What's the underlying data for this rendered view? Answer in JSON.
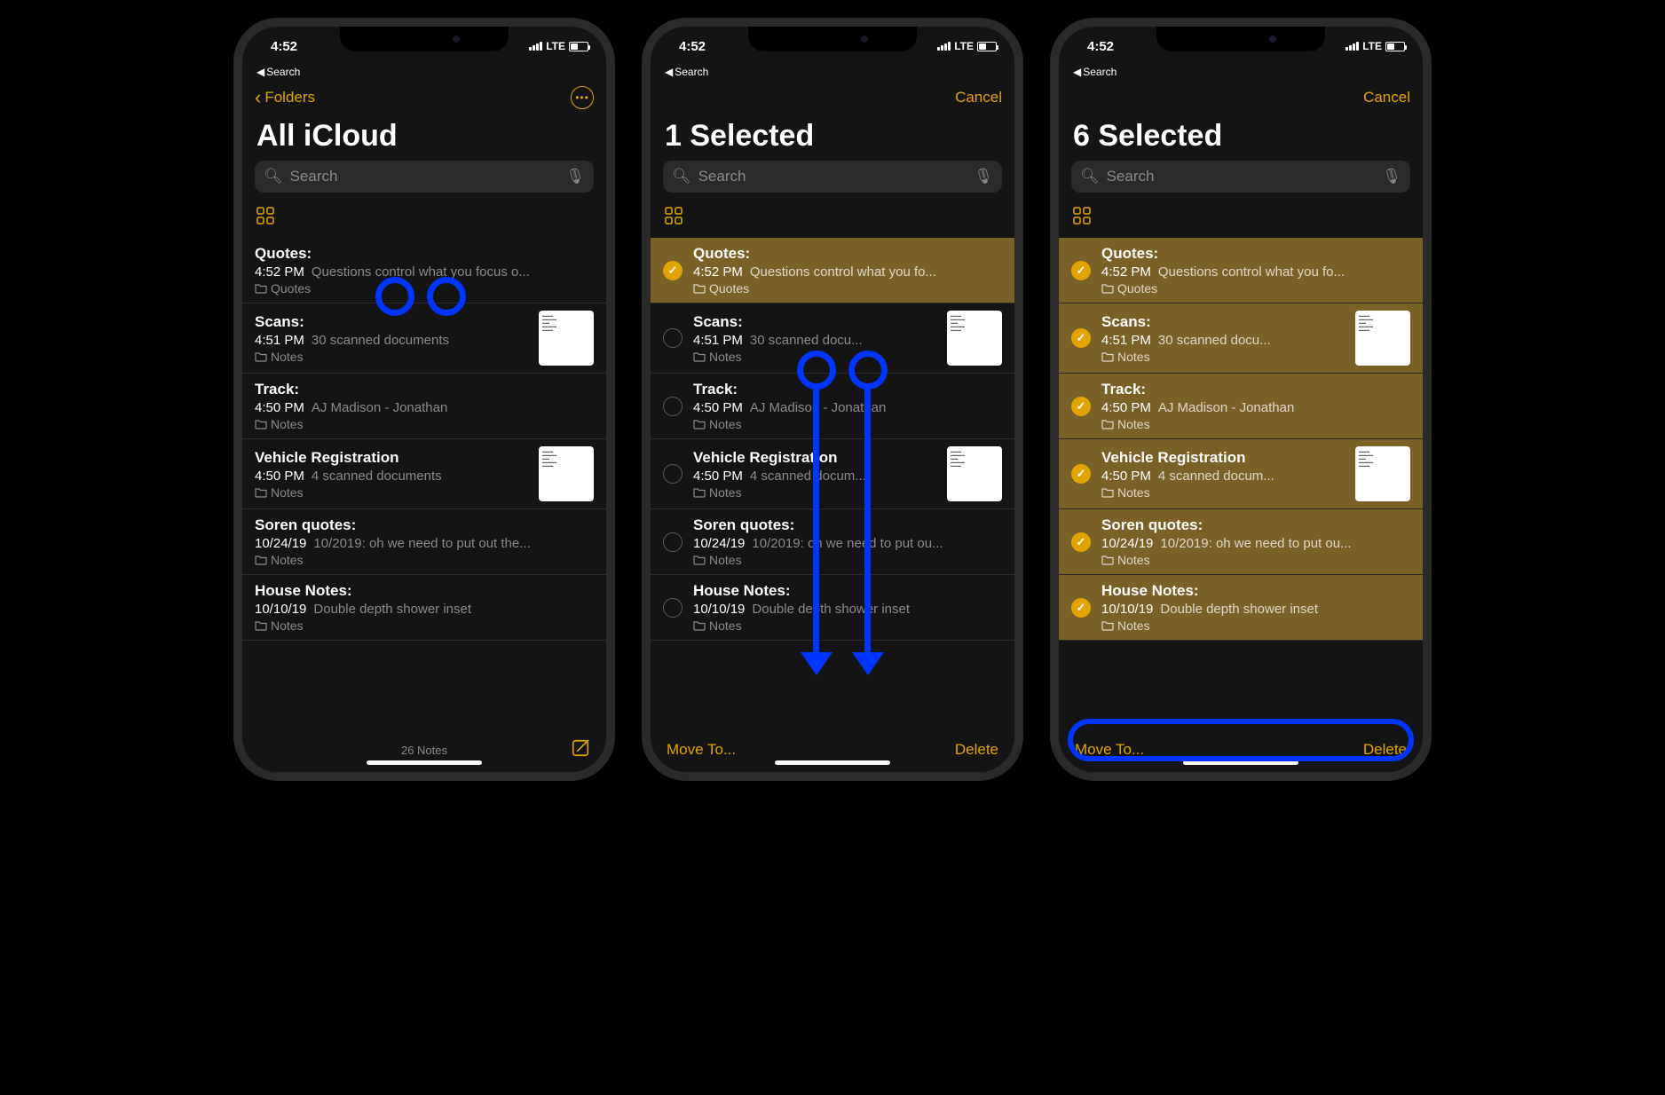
{
  "status": {
    "time": "4:52",
    "carrier": "LTE",
    "back_app": "Search"
  },
  "accent": "#e2a400",
  "phones": [
    {
      "nav": {
        "back": "Folders",
        "title": "All iCloud",
        "has_more": true
      },
      "search_placeholder": "Search",
      "footer": {
        "center": "26 Notes",
        "compose": true
      }
    },
    {
      "nav": {
        "cancel": "Cancel",
        "title": "1 Selected"
      },
      "search_placeholder": "Search",
      "footer": {
        "left": "Move To...",
        "right": "Delete"
      }
    },
    {
      "nav": {
        "cancel": "Cancel",
        "title": "6 Selected"
      },
      "search_placeholder": "Search",
      "footer": {
        "left": "Move To...",
        "right": "Delete"
      }
    }
  ],
  "notes": [
    {
      "title": "Quotes:",
      "time": "4:52 PM",
      "preview": "Questions control what you focus o...",
      "preview_mid": "Questions control what you fo...",
      "folder": "Quotes",
      "thumb": false
    },
    {
      "title": "Scans:",
      "time": "4:51 PM",
      "preview": "30 scanned documents",
      "preview_mid": "30 scanned docu...",
      "folder": "Notes",
      "thumb": true
    },
    {
      "title": "Track:",
      "time": "4:50 PM",
      "preview": "AJ Madison - Jonathan",
      "preview_mid": "AJ Madison - Jonathan",
      "folder": "Notes",
      "thumb": false
    },
    {
      "title": "Vehicle Registration",
      "time": "4:50 PM",
      "preview": "4 scanned documents",
      "preview_mid": "4 scanned docum...",
      "folder": "Notes",
      "thumb": true
    },
    {
      "title": "Soren quotes:",
      "time": "10/24/19",
      "preview": "10/2019: oh we need to put out the...",
      "preview_mid": "10/2019: oh we need to put ou...",
      "folder": "Notes",
      "thumb": false
    },
    {
      "title": "House Notes:",
      "time": "10/10/19",
      "preview": "Double depth shower inset",
      "preview_mid": "Double depth shower inset",
      "folder": "Notes",
      "thumb": false
    }
  ],
  "selection": {
    "phone2_checked": [
      true,
      false,
      false,
      false,
      false,
      false
    ],
    "phone3_checked": [
      true,
      true,
      true,
      true,
      true,
      true
    ]
  }
}
